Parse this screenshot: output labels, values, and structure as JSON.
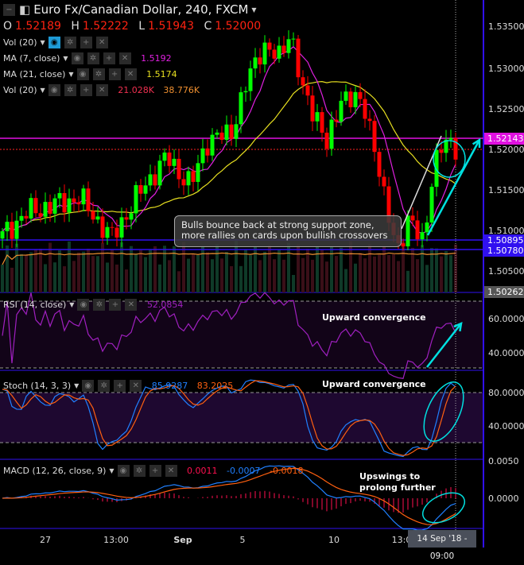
{
  "header": {
    "title": "Euro Fx/Canadian Dollar, 240, FXCM",
    "o_label": "O",
    "o": "1.52189",
    "h_label": "H",
    "h": "1.52222",
    "l_label": "L",
    "l": "1.51943",
    "c_label": "C",
    "c": "1.52000"
  },
  "indicators": {
    "vol1": {
      "label": "Vol (20)"
    },
    "ma7": {
      "label": "MA (7, close)",
      "value": "1.5192",
      "color": "#e020e0"
    },
    "ma21": {
      "label": "MA (21, close)",
      "value": "1.5174",
      "color": "#e8e020"
    },
    "vol2": {
      "label": "Vol (20)",
      "value1": "21.028K",
      "value2": "38.776K"
    },
    "rsi": {
      "label": "RSI (14, close)",
      "value": "52.0854"
    },
    "stoch": {
      "label": "Stoch (14, 3, 3)",
      "k": "85.9287",
      "d": "83.2025"
    },
    "macd": {
      "label": "MACD (12, 26, close, 9)",
      "hist": "0.0011",
      "macd": "-0.0007",
      "signal": "-0.0018"
    }
  },
  "price_axis": [
    "1.53500",
    "1.53000",
    "1.52500",
    "1.52000",
    "1.51500",
    "1.51000",
    "1.50500"
  ],
  "price_labels": {
    "resistance": "1.52143",
    "last": "1.52000",
    "support1": "1.50895",
    "support2": "1.50780",
    "bottom": "1.50262"
  },
  "rsi_axis": [
    "60.0000",
    "40.0000"
  ],
  "stoch_axis": [
    "80.0000",
    "40.0000"
  ],
  "macd_axis": [
    "0.0050",
    "0.0000"
  ],
  "time_axis": [
    "27",
    "13:00",
    "Sep",
    "5",
    "10",
    "13:0"
  ],
  "cursor_time": "14 Sep '18 - 09:00",
  "annotations": {
    "callout": [
      "Bulls bounce back at strong support zone,",
      "more rallies on cards upon bullish crossovers"
    ],
    "rsi_note": "Upward convergence",
    "stoch_note": "Upward convergence",
    "macd_note": [
      "Upswings to",
      "prolong further"
    ]
  },
  "colors": {
    "up": "#00ff00",
    "down": "#ff0000",
    "rsi": "#a020c0",
    "stoch_k": "#2080ff",
    "stoch_d": "#ff6010",
    "macd": "#2080ff",
    "signal": "#ff6010",
    "hist": "#ff1050",
    "accent": "#00e0e0"
  },
  "chart_data": {
    "type": "candlestick",
    "symbol": "EURCAD",
    "timeframe": "240",
    "close_path": [
      [
        0,
        1.509
      ],
      [
        30,
        1.512
      ],
      [
        60,
        1.513
      ],
      [
        100,
        1.514
      ],
      [
        125,
        1.511
      ],
      [
        140,
        1.509
      ],
      [
        165,
        1.513
      ],
      [
        185,
        1.516
      ],
      [
        210,
        1.519
      ],
      [
        240,
        1.5155
      ],
      [
        260,
        1.521
      ],
      [
        290,
        1.522
      ],
      [
        310,
        1.528
      ],
      [
        330,
        1.533
      ],
      [
        350,
        1.531
      ],
      [
        365,
        1.535
      ],
      [
        380,
        1.527
      ],
      [
        400,
        1.524
      ],
      [
        412,
        1.52
      ],
      [
        430,
        1.527
      ],
      [
        460,
        1.525
      ],
      [
        470,
        1.521
      ],
      [
        482,
        1.514
      ],
      [
        500,
        1.508
      ],
      [
        515,
        1.511
      ],
      [
        532,
        1.509
      ],
      [
        545,
        1.517
      ],
      [
        556,
        1.5205
      ],
      [
        566,
        1.5215
      ],
      [
        575,
        1.52
      ]
    ],
    "ylim": [
      1.5026,
      1.5372
    ],
    "support_levels": [
      1.50895,
      1.5078
    ],
    "resistance_level": 1.52143
  }
}
